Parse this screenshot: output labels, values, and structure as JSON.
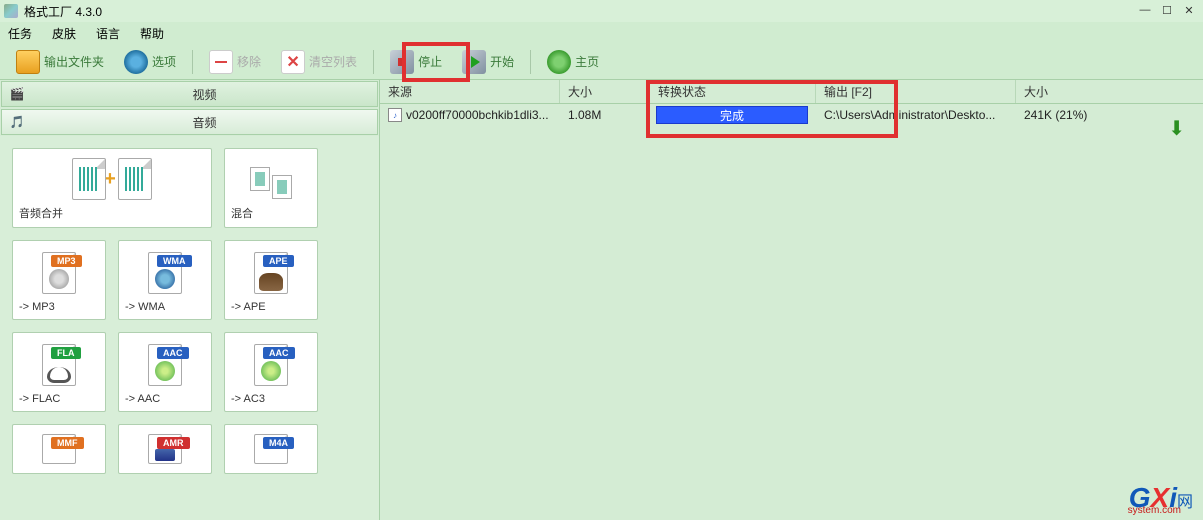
{
  "window": {
    "title": "格式工厂 4.3.0"
  },
  "menu": {
    "task": "任务",
    "skin": "皮肤",
    "language": "语言",
    "help": "帮助"
  },
  "toolbar": {
    "output_folder": "输出文件夹",
    "options": "选项",
    "remove": "移除",
    "clear": "清空列表",
    "stop": "停止",
    "start": "开始",
    "home": "主页"
  },
  "sidebar": {
    "video": "视频",
    "audio": "音频",
    "merge": "音频合并",
    "mix": "混合",
    "mp3": "-> MP3",
    "wma": "-> WMA",
    "ape": "-> APE",
    "flac": "-> FLAC",
    "aac": "-> AAC",
    "ac3": "-> AC3",
    "badges": {
      "mp3": "MP3",
      "wma": "WMA",
      "ape": "APE",
      "fla": "FLA",
      "aac": "AAC",
      "mmf": "MMF",
      "amr": "AMR",
      "m4a": "M4A"
    }
  },
  "table": {
    "headers": {
      "source": "来源",
      "size": "大小",
      "status": "转换状态",
      "output": "输出 [F2]",
      "outsize": "大小"
    },
    "row": {
      "filename": "v0200ff70000bchkib1dli3...",
      "size": "1.08M",
      "status": "完成",
      "output": "C:\\Users\\Administrator\\Deskto...",
      "outsize": "241K  (21%)"
    }
  },
  "watermark": {
    "suffix": "网",
    "sub": "system.com"
  }
}
